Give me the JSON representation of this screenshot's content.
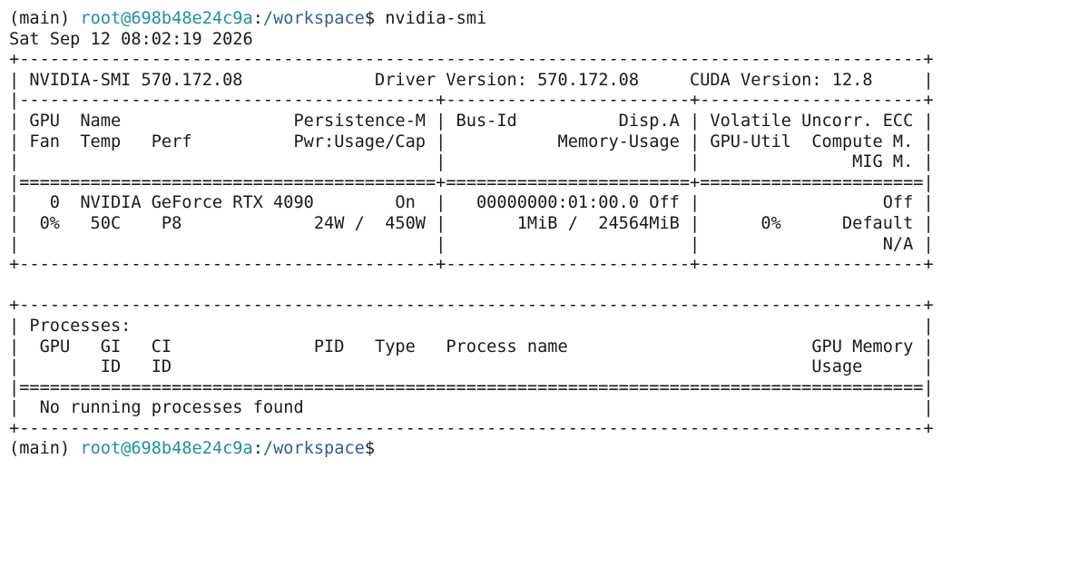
{
  "theme": {
    "background": "#ffffff",
    "text": "#1a1a1a",
    "user_color": "#1f8fa0",
    "path_color": "#2f5f9e"
  },
  "prompt1": {
    "env": "(main) ",
    "user_host": "root@698b48e24c9a",
    "colon": ":",
    "path": "/workspace",
    "symbol": "$ ",
    "command": "nvidia-smi"
  },
  "output": [
    "Sat Sep 12 08:02:19 2026",
    "+-----------------------------------------------------------------------------------------+",
    "| NVIDIA-SMI 570.172.08             Driver Version: 570.172.08     CUDA Version: 12.8     |",
    "|-----------------------------------------+------------------------+----------------------+",
    "| GPU  Name                 Persistence-M | Bus-Id          Disp.A | Volatile Uncorr. ECC |",
    "| Fan  Temp   Perf          Pwr:Usage/Cap |           Memory-Usage | GPU-Util  Compute M. |",
    "|                                         |                        |               MIG M. |",
    "|=========================================+========================+======================|",
    "|   0  NVIDIA GeForce RTX 4090        On  |   00000000:01:00.0 Off |                  Off |",
    "|  0%   50C    P8             24W /  450W |       1MiB /  24564MiB |      0%      Default |",
    "|                                         |                        |                  N/A |",
    "+-----------------------------------------+------------------------+----------------------+",
    "",
    "+-----------------------------------------------------------------------------------------+",
    "| Processes:                                                                              |",
    "|  GPU   GI   CI              PID   Type   Process name                        GPU Memory |",
    "|        ID   ID                                                               Usage      |",
    "|=========================================================================================|",
    "|  No running processes found                                                             |",
    "+-----------------------------------------------------------------------------------------+"
  ],
  "prompt2": {
    "env": "(main) ",
    "user_host": "root@698b48e24c9a",
    "colon": ":",
    "path": "/workspace",
    "symbol": "$"
  }
}
